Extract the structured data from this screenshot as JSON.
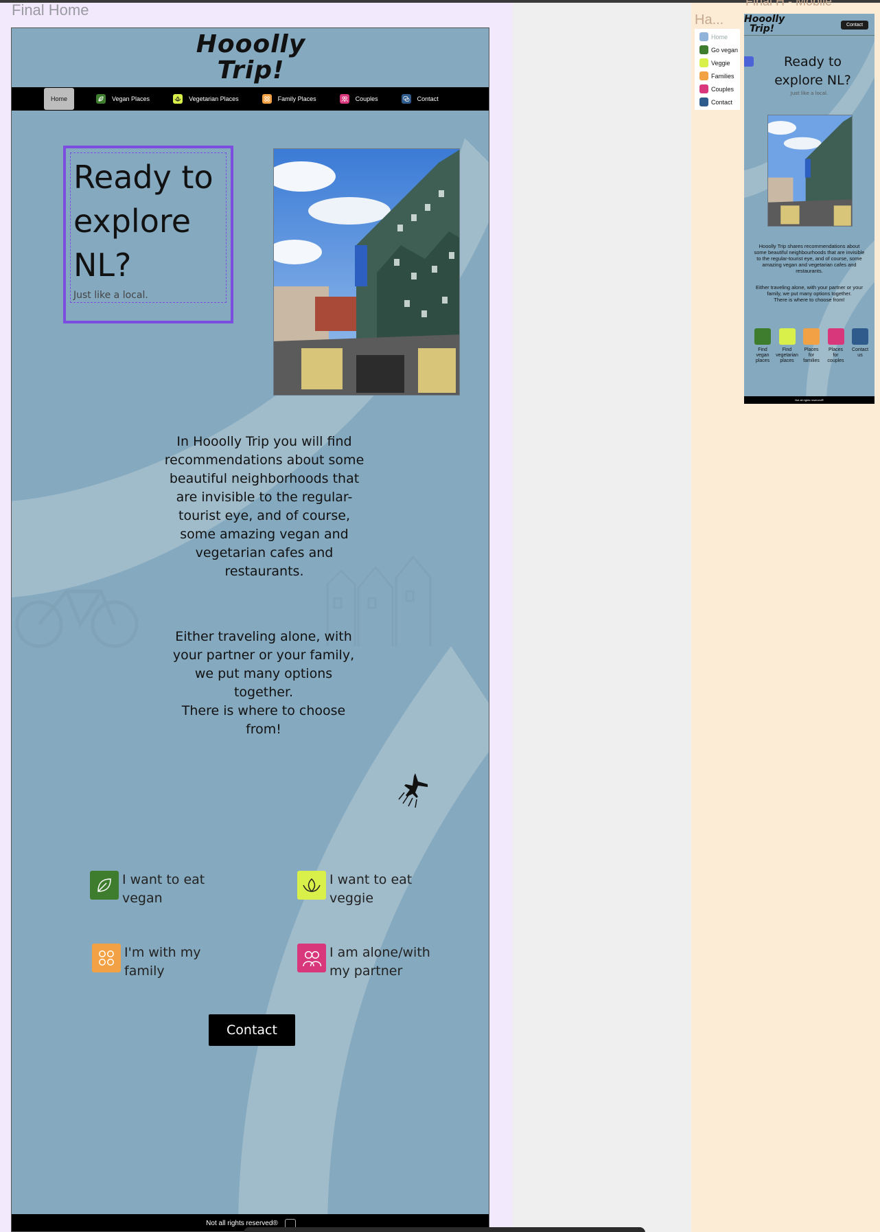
{
  "canvas": {
    "desktop_frame_label": "Final Home",
    "hamburger_frame_label": "Ha...",
    "mobile_frame_label": "Final H - Mobile"
  },
  "desktop": {
    "logo_line1": "Hooolly",
    "logo_line2": "Trip!",
    "nav": [
      {
        "label": "Home",
        "icon": "house-icon",
        "color": "#bdbdbd",
        "active": true
      },
      {
        "label": "Vegan Places",
        "icon": "leaf-icon",
        "color": "#3f7d2e"
      },
      {
        "label": "Vegetarian Places",
        "icon": "lotus-icon",
        "color": "#d9f04a"
      },
      {
        "label": "Family Places",
        "icon": "family-icon",
        "color": "#f2a244"
      },
      {
        "label": "Couples",
        "icon": "couple-icon",
        "color": "#d8377c"
      },
      {
        "label": "Contact",
        "icon": "chat-icon",
        "color": "#2e5a8c"
      }
    ],
    "hero_title": "Ready to explore NL?",
    "hero_subtitle": "Just like a local.",
    "paragraph1": "In Hooolly Trip you will find recommendations about some beautiful neighborhoods that are invisible to the regular-tourist eye, and of course, some amazing vegan and vegetarian cafes and restaurants.",
    "paragraph2_line1": "Either traveling alone, with your partner or your family, we put many options together.",
    "paragraph2_line2": "There is where to choose from!",
    "options": [
      {
        "label": "I want to eat vegan",
        "icon": "leaf-icon",
        "color": "#3f7d2e"
      },
      {
        "label": "I want to eat veggie",
        "icon": "lotus-icon",
        "color": "#d9f04a"
      },
      {
        "label": "I'm with my family",
        "icon": "family-icon",
        "color": "#f2a244"
      },
      {
        "label": "I am alone/with my partner",
        "icon": "couple-icon",
        "color": "#d8377c"
      }
    ],
    "contact_button": "Contact",
    "footer_text": "Not all rights reserved®"
  },
  "hamburger_menu": {
    "items": [
      {
        "label": "Home",
        "icon": "house-icon",
        "color": "#8fb3d9"
      },
      {
        "label": "Go vegan",
        "icon": "leaf-icon",
        "color": "#3f7d2e"
      },
      {
        "label": "Veggie",
        "icon": "lotus-icon",
        "color": "#d9f04a"
      },
      {
        "label": "Families",
        "icon": "family-icon",
        "color": "#f2a244"
      },
      {
        "label": "Couples",
        "icon": "couple-icon",
        "color": "#d8377c"
      },
      {
        "label": "Contact",
        "icon": "chat-icon",
        "color": "#2e5a8c"
      }
    ]
  },
  "mobile": {
    "logo_line1": "Hooolly",
    "logo_line2": "Trip!",
    "contact_button": "Contact",
    "hero_title": "Ready to explore NL?",
    "hero_subtitle": "Just like a local.",
    "paragraph1": "Hooolly Trip shares recommendations about some beautiful neighbourhoods that are invisible to the regular-tourist eye, and of course, some amazing vegan and vegetarian cafes and restaurants.",
    "paragraph2_line1": "Either traveling alone, with your partner or your family, we put many options together.",
    "paragraph2_line2": "There is where to choose from!",
    "icons": [
      {
        "label": "Find vegan places",
        "icon": "leaf-icon",
        "color": "#3f7d2e"
      },
      {
        "label": "Find vegetarian places",
        "icon": "lotus-icon",
        "color": "#d9f04a"
      },
      {
        "label": "Places for families",
        "icon": "family-icon",
        "color": "#f2a244"
      },
      {
        "label": "Places for couples",
        "icon": "couple-icon",
        "color": "#d8377c"
      },
      {
        "label": "Contact us",
        "icon": "chat-icon",
        "color": "#2e5a8c"
      }
    ],
    "footer_text": "Not all rights reserved®"
  }
}
